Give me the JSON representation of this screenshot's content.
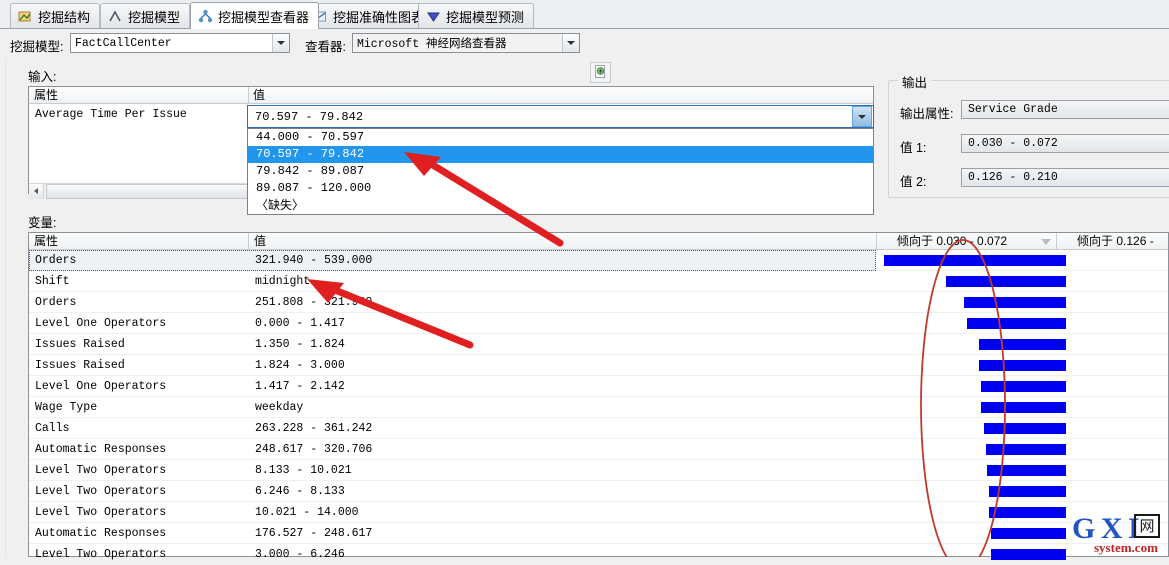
{
  "tabs": [
    {
      "label": "挖掘结构",
      "icon": "structure-icon",
      "active": false
    },
    {
      "label": "挖掘模型",
      "icon": "model-icon",
      "active": false
    },
    {
      "label": "挖掘模型查看器",
      "icon": "viewer-icon",
      "active": true
    },
    {
      "label": "挖掘准确性图表",
      "icon": "accuracy-chart-icon",
      "active": false
    },
    {
      "label": "挖掘模型预测",
      "icon": "prediction-icon",
      "active": false
    }
  ],
  "toolbar": {
    "mining_model_label": "挖掘模型:",
    "mining_model_value": "FactCallCenter",
    "viewer_label": "查看器:",
    "viewer_value": "Microsoft 神经网络查看器",
    "refresh_icon": "refresh-document-icon"
  },
  "input": {
    "section_label": "输入:",
    "col_attribute": "属性",
    "col_value": "值",
    "attribute": "Average Time Per Issue",
    "selected_value": "70.597 - 79.842",
    "options": [
      "44.000 - 70.597",
      "70.597 - 79.842",
      "79.842 - 89.087",
      "89.087 - 120.000",
      "〈缺失〉"
    ],
    "selected_index": 1
  },
  "output": {
    "section_label": "输出",
    "attribute_label": "输出属性:",
    "attribute_value": "Service Grade",
    "value1_label": "值 1:",
    "value1": "0.030 - 0.072",
    "value2_label": "值 2:",
    "value2": "0.126 - 0.210"
  },
  "variables": {
    "section_label": "变量:",
    "col_attribute": "属性",
    "col_value": "值",
    "col_favors1": "倾向于 0.030 - 0.072",
    "col_favors2": "倾向于 0.126 -",
    "sort_indicator": "sort-descending-icon",
    "rows": [
      {
        "attribute": "Orders",
        "value": "321.940 - 539.000",
        "bar_start": 883,
        "bar_end": 1065,
        "selected": true
      },
      {
        "attribute": "Shift",
        "value": "midnight",
        "bar_start": 945,
        "bar_end": 1065
      },
      {
        "attribute": "Orders",
        "value": "251.808 - 321.940",
        "bar_start": 963,
        "bar_end": 1065
      },
      {
        "attribute": "Level One Operators",
        "value": "0.000 - 1.417",
        "bar_start": 966,
        "bar_end": 1065
      },
      {
        "attribute": "Issues Raised",
        "value": "1.350 - 1.824",
        "bar_start": 978,
        "bar_end": 1065
      },
      {
        "attribute": "Issues Raised",
        "value": "1.824 - 3.000",
        "bar_start": 978,
        "bar_end": 1065
      },
      {
        "attribute": "Level One Operators",
        "value": "1.417 - 2.142",
        "bar_start": 980,
        "bar_end": 1065
      },
      {
        "attribute": "Wage Type",
        "value": "weekday",
        "bar_start": 980,
        "bar_end": 1065
      },
      {
        "attribute": "Calls",
        "value": "263.228 - 361.242",
        "bar_start": 983,
        "bar_end": 1065
      },
      {
        "attribute": "Automatic Responses",
        "value": "248.617 - 320.706",
        "bar_start": 985,
        "bar_end": 1065
      },
      {
        "attribute": "Level Two Operators",
        "value": "8.133 - 10.021",
        "bar_start": 986,
        "bar_end": 1065
      },
      {
        "attribute": "Level Two Operators",
        "value": "6.246 - 8.133",
        "bar_start": 988,
        "bar_end": 1065
      },
      {
        "attribute": "Level Two Operators",
        "value": "10.021 - 14.000",
        "bar_start": 988,
        "bar_end": 1065
      },
      {
        "attribute": "Automatic Responses",
        "value": "176.527 - 248.617",
        "bar_start": 990,
        "bar_end": 1065
      },
      {
        "attribute": "Level Two Operators",
        "value": "3.000 - 6.246",
        "bar_start": 990,
        "bar_end": 1065
      }
    ]
  },
  "annotations": {
    "color": "#e02020",
    "arrow1": "red-arrow-to-selected-option",
    "arrow2": "red-arrow-to-shift-value",
    "ellipse": "red-ellipse-around-bars"
  },
  "watermark": {
    "main": "G X I",
    "cn": "网",
    "sub": "system.com"
  }
}
